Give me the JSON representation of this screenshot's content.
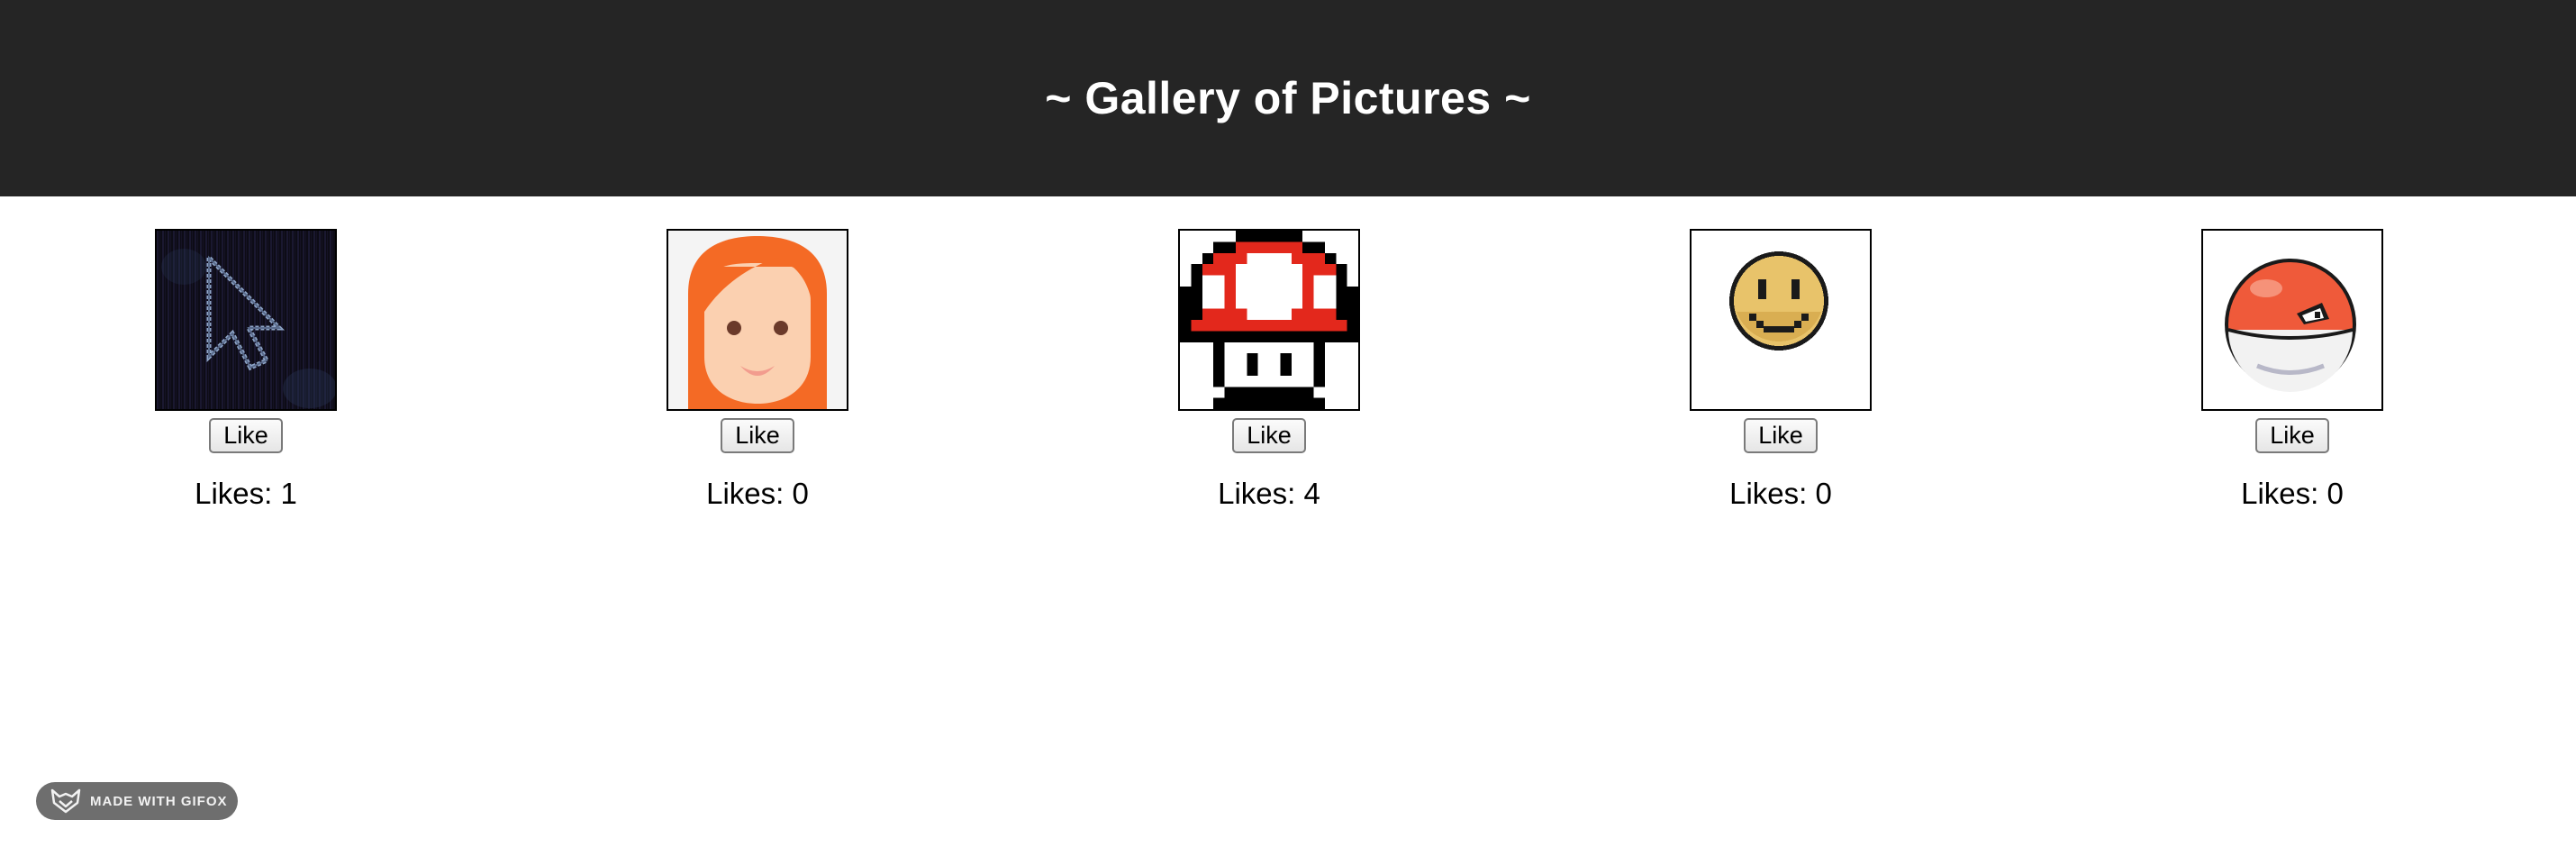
{
  "header": {
    "title": "~ Gallery of Pictures ~"
  },
  "gallery": {
    "items": [
      {
        "image_icon": "pixel-cursor-arrow-icon",
        "like_label": "Like",
        "likes_text": "Likes: 1"
      },
      {
        "image_icon": "red-haired-woman-avatar-icon",
        "like_label": "Like",
        "likes_text": "Likes: 0"
      },
      {
        "image_icon": "pixel-mushroom-icon",
        "like_label": "Like",
        "likes_text": "Likes: 4"
      },
      {
        "image_icon": "pixel-smiley-face-icon",
        "like_label": "Like",
        "likes_text": "Likes: 0"
      },
      {
        "image_icon": "pixel-red-ball-creature-icon",
        "like_label": "Like",
        "likes_text": "Likes: 0"
      }
    ]
  },
  "badge": {
    "label": "MADE WITH GIFOX",
    "icon": "fox-logo-icon"
  },
  "colors": {
    "header_bg": "#252525",
    "header_text": "#ffffff",
    "badge_bg": "#6e6e6e"
  }
}
